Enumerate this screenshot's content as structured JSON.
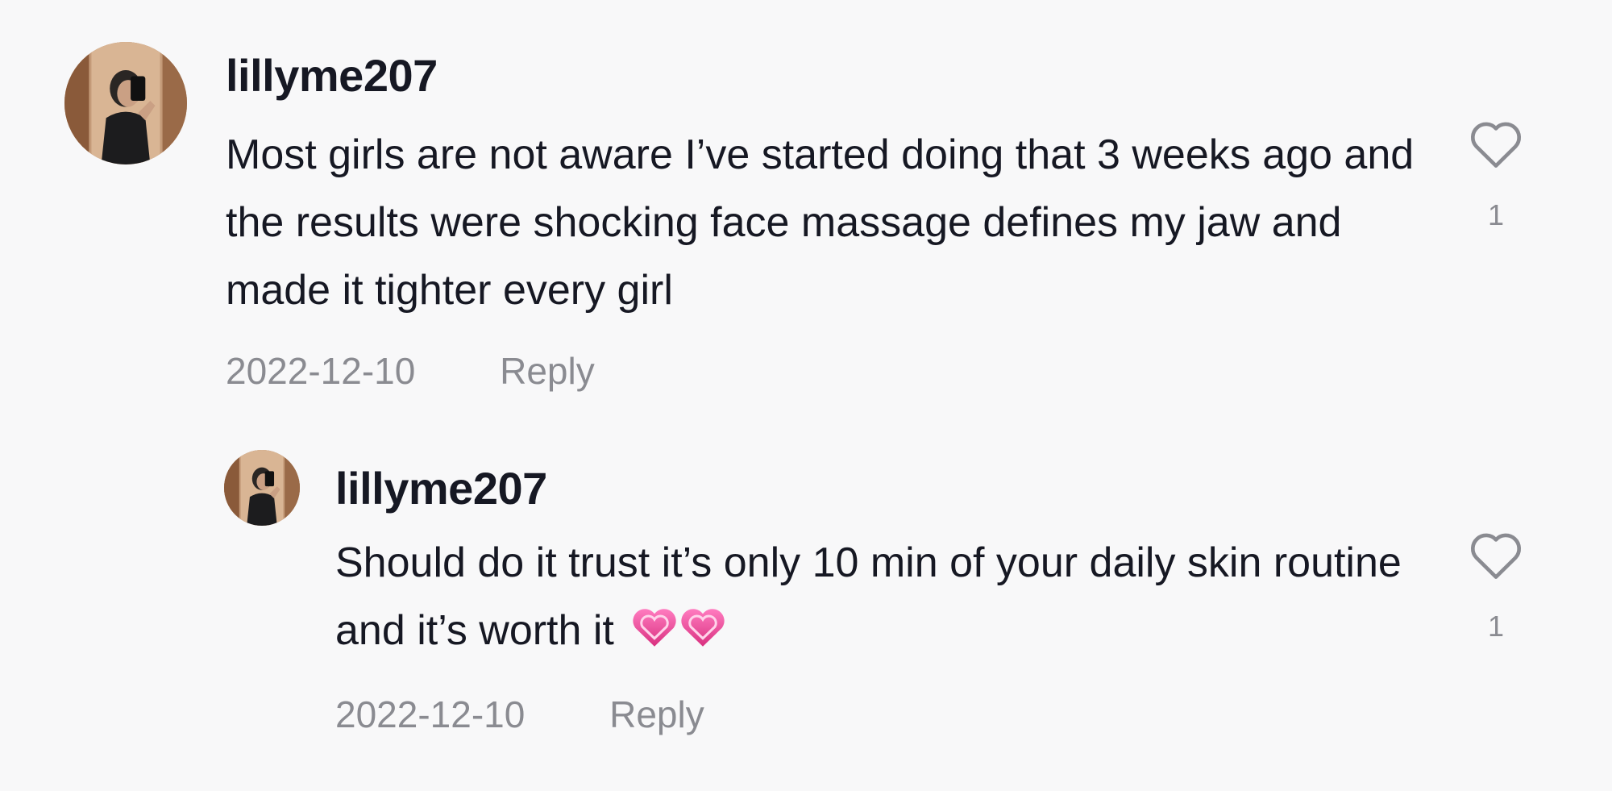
{
  "colors": {
    "background": "#f8f8f9",
    "text": "#161823",
    "secondary_text": "#8a8b91",
    "heart_outline": "#8a8b91",
    "emoji_pink": "#e8479b"
  },
  "comments": [
    {
      "username": "lillyme207",
      "avatar_icon": "profile-photo",
      "text": "Most girls are not aware I’ve started doing that 3 weeks ago and the results were shocking face massage defines my jaw and made it tighter every girl",
      "date": "2022-12-10",
      "reply_label": "Reply",
      "like_icon": "heart-outline-icon",
      "like_count": "1"
    },
    {
      "username": "lillyme207",
      "avatar_icon": "profile-photo",
      "text": "Should do it trust it’s only 10 min of your daily skin routine and it’s worth it",
      "emoji": "💗💗",
      "date": "2022-12-10",
      "reply_label": "Reply",
      "like_icon": "heart-outline-icon",
      "like_count": "1"
    }
  ]
}
